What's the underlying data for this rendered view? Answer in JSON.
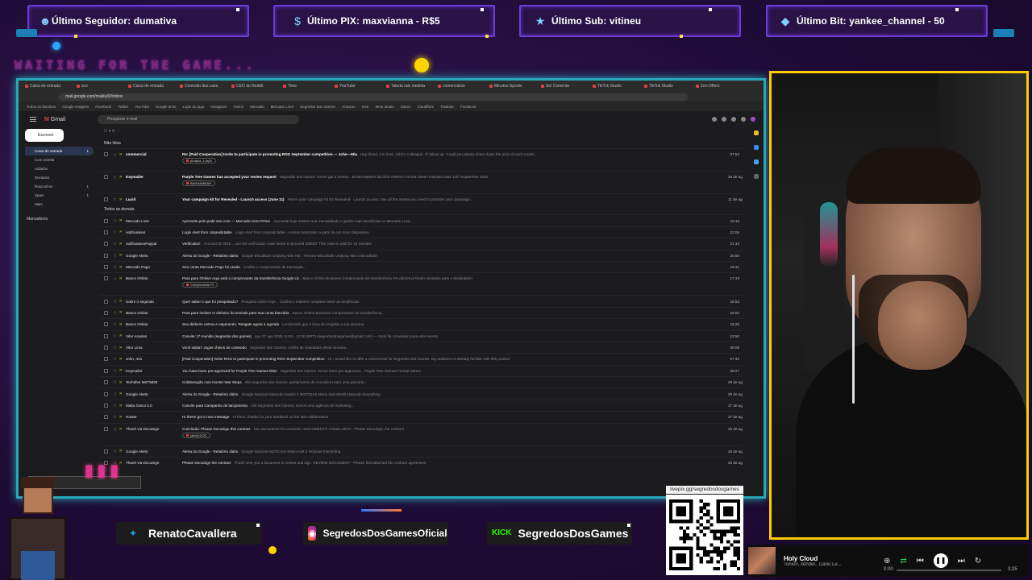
{
  "alerts": [
    {
      "icon": "person-icon",
      "text": "Último Seguidor: dumativa"
    },
    {
      "icon": "pix-icon",
      "text": "Último PIX: maxvianna - R$5"
    },
    {
      "icon": "star-icon",
      "text": "Último Sub: vitineu"
    },
    {
      "icon": "diamond-icon",
      "text": "Último Bit: yankee_channel - 50"
    }
  ],
  "waiting_text": "WAITING FOR THE GAME...",
  "browser": {
    "tabs": [
      "Caixa de entrada",
      "sco",
      "Caixa de entrada",
      "Conexão das casa",
      "CEO do Reddit",
      "Time",
      "YouTube",
      "Tabela sob medida",
      "comercialsio",
      "Minutos Sportie",
      "Sol Comenta",
      "TikTok Studio",
      "TikTok Studio",
      "Zen Offers"
    ],
    "url": "mail.google.com/mail/u/0/#inbox",
    "bookmarks": [
      "Todos os favoritos",
      "Google Imagens",
      "Facebook",
      "Twitter",
      "YouTube",
      "Google drive",
      "Lojas do jogo",
      "Instagram",
      "Twitch",
      "Mercado",
      "Mercado Livre",
      "Segredos Dos Games",
      "Amazon",
      "Kick",
      "Itens atuais",
      "Steam",
      "Cloudflare",
      "Tradutor",
      "Facebook"
    ]
  },
  "gmail": {
    "logo": "Gmail",
    "search_placeholder": "Pesquisar e-mail",
    "compose_label": "Escrever",
    "sidebar": [
      {
        "label": "Caixa de entrada",
        "count": "1",
        "active": true
      },
      {
        "label": "Com estrela",
        "count": "",
        "active": false
      },
      {
        "label": "Adiados",
        "count": "",
        "active": false
      },
      {
        "label": "Enviados",
        "count": "",
        "active": false
      },
      {
        "label": "Rascunhos",
        "count": "1",
        "active": false
      },
      {
        "label": "Spam",
        "count": "1",
        "active": false
      },
      {
        "label": "Mais",
        "count": "",
        "active": false
      }
    ],
    "labels_heading": "Marcadores",
    "section_unread": "Não lidos",
    "section_all": "Todos os demais",
    "unread": [
      {
        "from": "commercial",
        "subject": "Re: [Paid Cooperation] Invite to participate in promoting ROG September competition — John—Mia",
        "snippet": "Hey friend, it is here, John's colleague. I'll follow up. Could you please share down the price of each model...",
        "date": "07:52",
        "chip": "product_1.mp4"
      },
      {
        "from": "Keymailer",
        "subject": "Purple Tree Games has accepted your review request",
        "snippet": "Segredos dos Games You've got a review... BANHAMMAR BLOOD ARENA Format Steam Release Date 11th September 2025",
        "date": "26 de ago",
        "chip": "BANHAMMAR"
      },
      {
        "from": "Lucid",
        "subject": "Your campaign kit for Revealed - Launch access (June 11)",
        "snippet": "Here's your campaign kit for Revealed - Launch access. Use all the assets you need to promote your campaign...",
        "date": "11 de ago",
        "chip": ""
      }
    ],
    "all": [
      {
        "from": "Mercado Livre",
        "subject": "Aproveite pelo pedir seu com — Mercado Livre Prime",
        "snippet": "Aproveite hoje mesmo sua mensalidade e ganhe mais benefícios no Mercado Livre...",
        "date": "23:15"
      },
      {
        "from": "notifications",
        "subject": "Login Alert from Unpredictable",
        "snippet": "Login Alert from Unpredictable - Acesso detectado a partir de um novo dispositivo",
        "date": "22:06"
      },
      {
        "from": "notificationsPaypal",
        "subject": "Verification",
        "snippet": "Account ID 4918... use the verification code below to proceed 356037 This code is valid for 10 minutes",
        "date": "21:14"
      },
      {
        "from": "Google Alerts",
        "subject": "Alerta do Google - Relatório diário",
        "snippet": "Google BloodBath Undying War HD... Review Bloodbath Undying War a Bloodbath",
        "date": "20:50"
      },
      {
        "from": "Mercado Pago",
        "subject": "Seu conta Mercado Pago foi usada",
        "snippet": "Confira o comprovante da transação...",
        "date": "19:31"
      },
      {
        "from": "Banco Online",
        "subject": "Para para Online! Aqui está o comprovante da transferência Google Llc",
        "snippet": "Banco Online Business Comprovante da transferência Os valores já foram enviados para o destinatário",
        "date": "17:13",
        "chip": "Comprovante PI"
      },
      {
        "from": "Sobre o segundo",
        "subject": "Quer saber o que foi pesquisado?",
        "snippet": "Pesquisa online hoje... Confira o relatório completo sobre as tendências",
        "date": "16:53"
      },
      {
        "from": "Banco Online",
        "subject": "Para para Online! O dinheiro foi enviado para sua conta bancária",
        "snippet": "Banco Online Business Comprovante de transferência...",
        "date": "16:02"
      },
      {
        "from": "Banco Online",
        "subject": "Seu dinheiro entrou e esperando. Resgate agora a agenda",
        "snippet": "Lembrando que é hora de resgatar a sua semana",
        "date": "15:25"
      },
      {
        "from": "Vitor Arantes",
        "subject": "Convite: 1ª reunião (segredos dos games)",
        "snippet": "qua 27 ago 2025 11:00 - 12:00 (BRT) (segredosdosgames@gmail.com) — Você foi convidado para este evento",
        "date": "13:50"
      },
      {
        "from": "Vitor Lima",
        "subject": "Você sabia? Jogos cheios de conteúdo",
        "snippet": "Segredos dos Games, confira as novidades desta semana...",
        "date": "09:09"
      },
      {
        "from": "John, mia",
        "subject": "[Paid Cooperation] Invite ROG to participate in promoting ROG September competition",
        "snippet": "Hi, I would like to offer a commercial for Segredos dos Games. My audience is already familiar with this product",
        "date": "07:40"
      },
      {
        "from": "Keymailer",
        "subject": "You have been pre-approved for Purple Tree Games titles",
        "snippet": "Segredos dos Games You've been pre-approved... Purple Tree Games Format Steam",
        "date": "06:27"
      },
      {
        "from": "Techshot MKTMDE",
        "subject": "Colaboração com Hunter War Steps",
        "snippet": "Olá Segredos dos Games, gostaríamos de convidá-lo para uma parceria...",
        "date": "29 de ago"
      },
      {
        "from": "Google Alerts",
        "subject": "Alerta do Google - Relatório diário",
        "snippet": "Google Notícias Nintendo Switch 2 NOTÍCIAS Mario Kart World Nintendo Everything",
        "date": "28 de ago"
      },
      {
        "from": "Malta Greco 5.0",
        "subject": "Convite para Campanha de lançamento",
        "snippet": "Olá Segredos dos Games, somos uma agência de marketing...",
        "date": "27 de ago"
      },
      {
        "from": "Hunter",
        "subject": "Hi there! got a new message",
        "snippet": "Hi there, thanks for your feedback on the last collaboration",
        "date": "27 de ago"
      },
      {
        "from": "Thanh via DocuSign",
        "subject": "Concluído: Please DocuSign this contract",
        "snippet": "Seu documento foi concluído. DOCUMENTO CONCLUÍDO - Please DocuSign: the contract",
        "date": "26 de ago",
        "chip": "[alive] DOC"
      },
      {
        "from": "Google Alerts",
        "subject": "Alerta do Google - Relatório diário",
        "snippet": "Google Notícias NOTÍCIAS Mario Kart 3 Notícias Everything",
        "date": "26 de ago"
      },
      {
        "from": "Thanh via DocuSign",
        "subject": "Please DocuSign the contract",
        "snippet": "Thanh sent you a document to review and sign. REVIEW DOCUMENT - Please find attached the contract agreement",
        "date": "26 de ago"
      }
    ]
  },
  "socials": [
    {
      "icon": "twitter-icon",
      "name": "RenatoCavallera"
    },
    {
      "icon": "instagram-icon",
      "name": "SegredosDosGamesOficial"
    },
    {
      "icon": "kick-icon",
      "name": "SegredosDosGames"
    }
  ],
  "kick_label": "KICK",
  "qr_url": "livepix.gg/segredosdosgames",
  "player": {
    "title": "Holy Cloud",
    "artists": "Tonion, xender., Dario Le...",
    "time_current": "0:00",
    "time_total": "3:25",
    "progress": 0
  },
  "colors": {
    "background": "#200c38",
    "capture_border": "#27a8b8",
    "webcam_border": "#ffcc00",
    "alert_border": "#6b3bd6"
  }
}
